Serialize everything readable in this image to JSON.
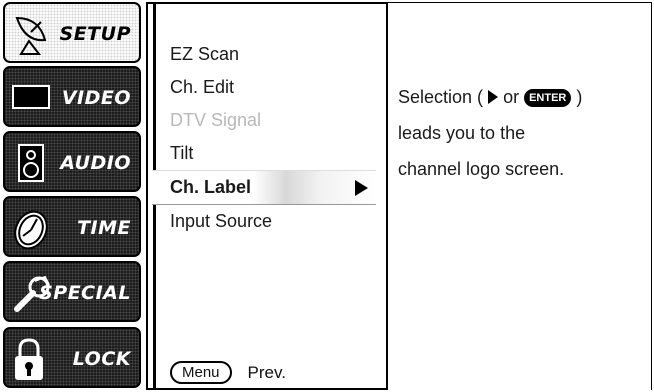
{
  "categories": [
    {
      "label": "SETUP",
      "icon": "satellite-dish-icon",
      "selected": true
    },
    {
      "label": "VIDEO",
      "icon": "tv-screen-icon",
      "selected": false
    },
    {
      "label": "AUDIO",
      "icon": "speaker-icon",
      "selected": false
    },
    {
      "label": "TIME",
      "icon": "clock-icon",
      "selected": false
    },
    {
      "label": "SPECIAL",
      "icon": "wrench-icon",
      "selected": false
    },
    {
      "label": "LOCK",
      "icon": "padlock-icon",
      "selected": false
    }
  ],
  "menu": {
    "items": [
      {
        "label": "EZ Scan",
        "state": "normal"
      },
      {
        "label": "Ch. Edit",
        "state": "normal"
      },
      {
        "label": "DTV Signal",
        "state": "disabled"
      },
      {
        "label": "Tilt",
        "state": "normal"
      },
      {
        "label": "Ch. Label",
        "state": "highlighted"
      },
      {
        "label": "Input Source",
        "state": "normal"
      }
    ],
    "footer": {
      "button": "Menu",
      "label": "Prev."
    }
  },
  "description": {
    "line1_prefix": "Selection (",
    "line1_or": " or ",
    "enter": "ENTER",
    "line1_suffix": " )",
    "line2": "leads you to the",
    "line3": "channel logo screen."
  }
}
